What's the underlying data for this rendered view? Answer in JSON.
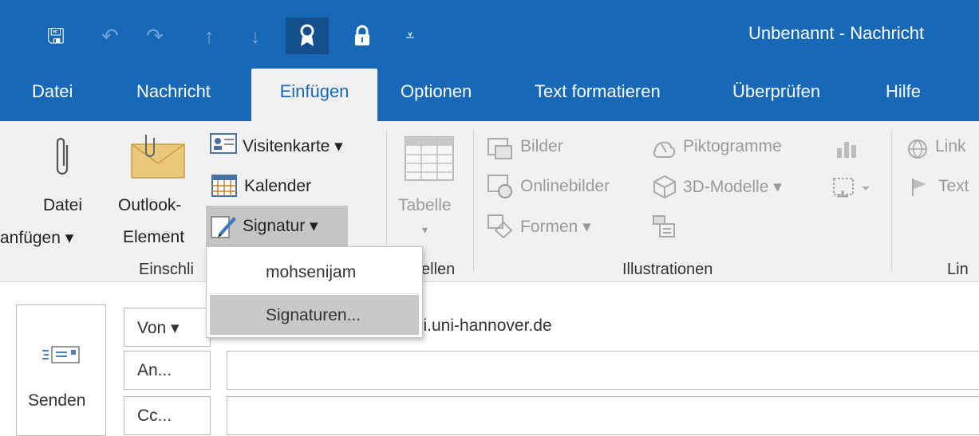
{
  "window": {
    "title": "Unbenannt  -  Nachricht"
  },
  "quick_access": [
    {
      "icon": "save-icon",
      "glyph": "🖫"
    },
    {
      "icon": "undo-icon",
      "glyph": "↶"
    },
    {
      "icon": "redo-icon",
      "glyph": "↷"
    },
    {
      "icon": "up-arrow-icon",
      "glyph": "↑"
    },
    {
      "icon": "down-arrow-icon",
      "glyph": "↓"
    },
    {
      "icon": "ribbon-badge-icon",
      "glyph": "🎖"
    },
    {
      "icon": "lock-icon",
      "glyph": "🔒"
    },
    {
      "icon": "customize-icon",
      "glyph": "⩡"
    }
  ],
  "tabs": [
    {
      "label": "Datei"
    },
    {
      "label": "Nachricht"
    },
    {
      "label": "Einfügen",
      "active": true
    },
    {
      "label": "Optionen"
    },
    {
      "label": "Text formatieren"
    },
    {
      "label": "Überprüfen"
    },
    {
      "label": "Hilfe"
    }
  ],
  "ribbon": {
    "attach_file": {
      "line1": "Datei",
      "line2": "anfügen ▾"
    },
    "outlook_item": {
      "line1": "Outlook-",
      "line2": "Element"
    },
    "business_card": "Visitenkarte ▾",
    "calendar": "Kalender",
    "signature": "Signatur ▾",
    "table": "Tabelle",
    "pictures": "Bilder",
    "online_pictures": "Onlinebilder",
    "shapes": "Formen ▾",
    "icons": "Piktogramme",
    "models_3d": "3D-Modelle  ▾",
    "link": "Link",
    "text": "Text",
    "groups": {
      "include": "Einschli",
      "tables": "ellen",
      "illustrations": "Illustrationen",
      "links": "Lin"
    }
  },
  "signature_menu": {
    "items": [
      "mohsenijam",
      "Signaturen..."
    ],
    "highlighted_index": 1
  },
  "compose": {
    "send_label": "Senden",
    "from_label": "Von ▾",
    "from_value": "vi.uni-hannover.de",
    "to_label": "An...",
    "cc_label": "Cc..."
  },
  "colors": {
    "title_bar": "#1769b8",
    "ribbon_bg": "#f1f1f1",
    "menu_highlight": "#c8c8c8"
  }
}
